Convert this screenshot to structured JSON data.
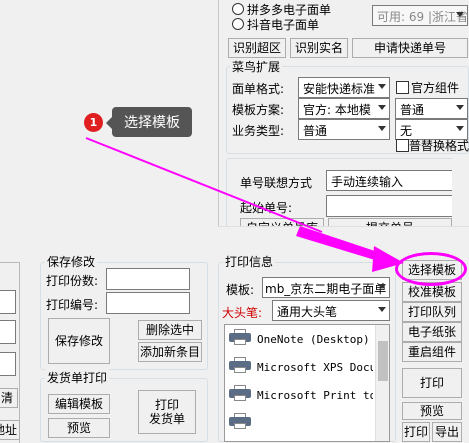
{
  "colors": {
    "accent": "#ff00ff",
    "badge": "#e02020",
    "tooltip_bg": "#555555",
    "red_label": "#d00000"
  },
  "tooltip": {
    "badge_number": "1",
    "text": "选择模板"
  },
  "top_radios": {
    "pdd": "拼多多电子面单",
    "douyin": "抖音电子面单"
  },
  "available": {
    "value": "可用: 69",
    "region": "浙江省"
  },
  "top_buttons": {
    "identify_over": "识别超区",
    "identify_name": "识别实名",
    "apply_waybill": "申请快递单号"
  },
  "cainiao": {
    "title": "菜鸟扩展",
    "format_label": "面单格式:",
    "format_value": "安能快递标准",
    "official_component": "官方组件",
    "template_label": "模板方案:",
    "template_value": "官方: 本地模",
    "template_type_value": "普通",
    "business_label": "业务类型:",
    "business_value": "普通",
    "business_extra_value": "无",
    "replace_format": "普替换格式"
  },
  "number": {
    "mode_label": "单号联想方式",
    "mode_value": "手动连续输入",
    "start_label": "起始单号:",
    "custom_lib": "自定义单号库",
    "submit": "提交单号"
  },
  "save_modify": {
    "title": "保存修改",
    "print_count_label": "打印份数:",
    "print_no_label": "打印编号:",
    "save_button": "保存修改",
    "delete_selected": "删除选中",
    "add_new": "添加新条目"
  },
  "ship_print": {
    "title": "发货单打印",
    "edit_template": "编辑模板",
    "preview": "预览",
    "print_ship": "打印\n发货单"
  },
  "print_info": {
    "title": "打印信息",
    "template_label": "模板:",
    "template_value": "mb_京东二期电子面单",
    "header_label": "大头笔:",
    "header_value": "通用大头笔",
    "printers": [
      "OneNote (Desktop)",
      "Microsoft XPS Document Writer",
      "Microsoft Print to PDF"
    ]
  },
  "right_buttons": {
    "select_template": "选择模板",
    "calibrate_template": "校准模板",
    "print_queue": "打印队列",
    "e_paper": "电子纸张",
    "restart_component": "重启组件",
    "print": "打印",
    "preview": "预览",
    "print_small": "打印",
    "export": "导出"
  },
  "left_partial": {
    "btn1": "清",
    "btn2": "地址"
  }
}
